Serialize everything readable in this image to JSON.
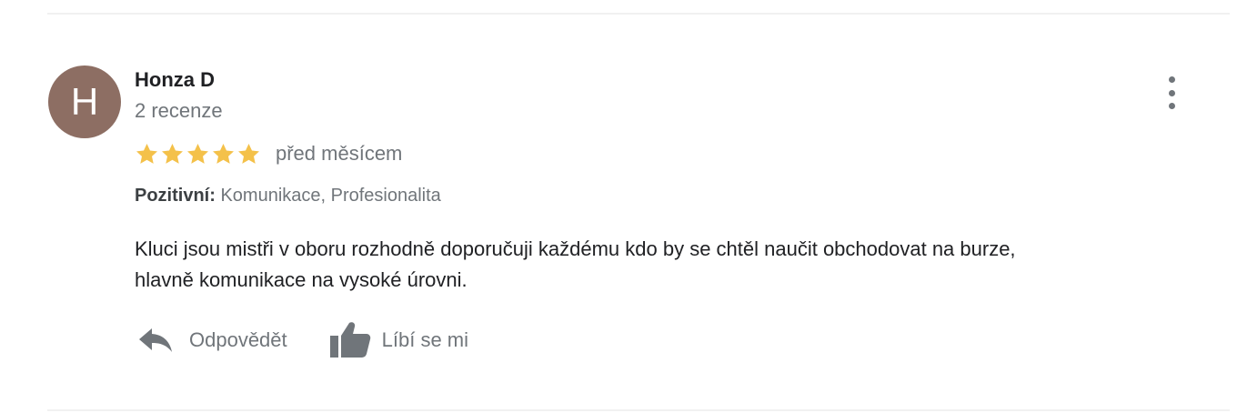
{
  "review": {
    "avatar_letter": "H",
    "avatar_color": "#8d6e63",
    "author_name": "Honza D",
    "reviews_count": "2 recenze",
    "rating": 5,
    "rating_max": 5,
    "star_color": "#f4c14a",
    "date": "před měsícem",
    "positive_label": "Pozitivní:",
    "positive_values": "Komunikace, Profesionalita",
    "text_line1": "Kluci jsou mistři v oboru rozhodně doporučuji každému kdo by se chtěl naučit obchodovat na burze,",
    "text_line2": "hlavně komunikace na vysoké úrovni."
  },
  "actions": {
    "reply_label": "Odpovědět",
    "like_label": "Líbí se mi"
  },
  "icons": {
    "more": "more-vert-icon",
    "reply": "reply-arrow-icon",
    "like": "thumbs-up-icon",
    "star": "star-icon"
  }
}
